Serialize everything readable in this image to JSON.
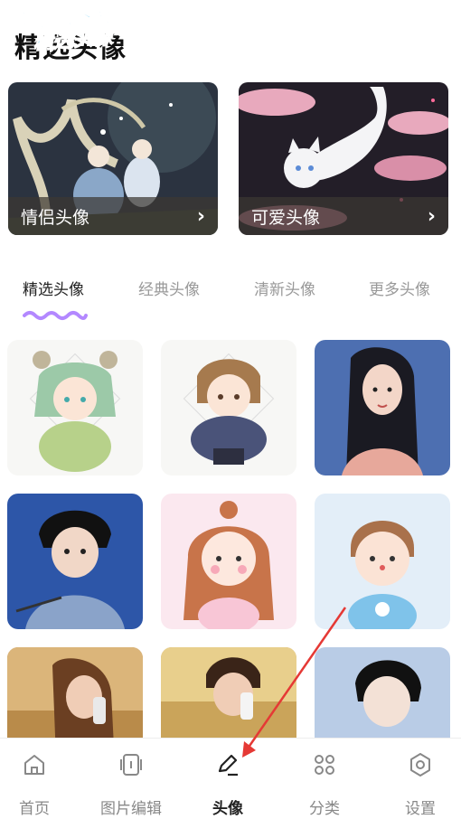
{
  "page": {
    "title": "精选头像"
  },
  "watermark": {
    "line1": "游吧乐下载",
    "line2": "精选头像"
  },
  "banners": [
    {
      "label": "情侣头像",
      "chevron": "›"
    },
    {
      "label": "可爱头像",
      "chevron": "›"
    }
  ],
  "tabs": [
    {
      "label": "精选头像",
      "active": true
    },
    {
      "label": "经典头像",
      "active": false
    },
    {
      "label": "清新头像",
      "active": false
    },
    {
      "label": "更多头像",
      "active": false
    }
  ],
  "nav": [
    {
      "label": "首页",
      "icon": "home-icon",
      "active": false
    },
    {
      "label": "图片编辑",
      "icon": "edit-frame-icon",
      "active": false
    },
    {
      "label": "头像",
      "icon": "pen-icon",
      "active": true
    },
    {
      "label": "分类",
      "icon": "grid-icon",
      "active": false
    },
    {
      "label": "设置",
      "icon": "settings-icon",
      "active": false
    }
  ],
  "colors": {
    "accent": "#b388ff",
    "annotation": "#e53935"
  }
}
